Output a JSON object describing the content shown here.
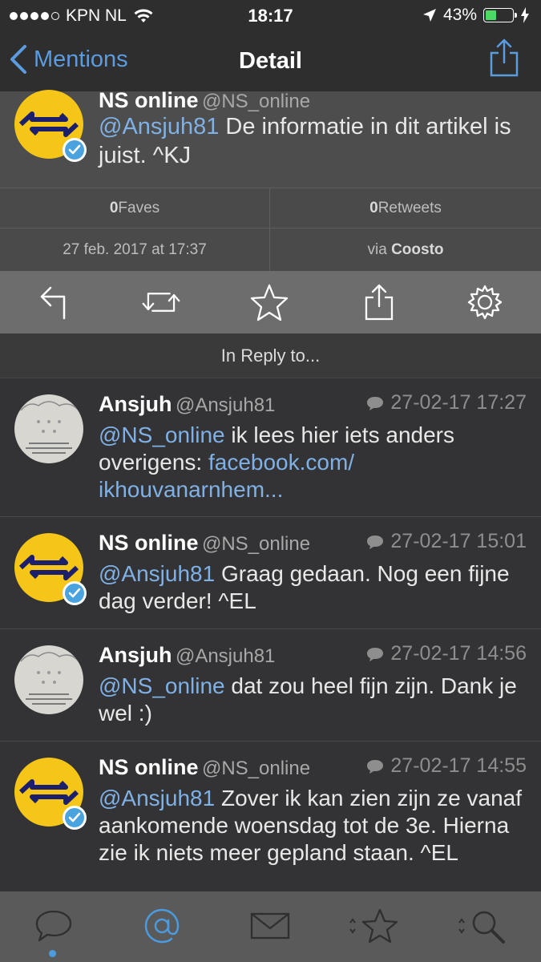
{
  "status_bar": {
    "carrier": "KPN NL",
    "time": "18:17",
    "battery": "43%",
    "battery_level": 0.43
  },
  "nav": {
    "back_label": "Mentions",
    "title": "Detail"
  },
  "main_tweet": {
    "name": "NS online",
    "handle": "@NS_online",
    "mention": "@Ansjuh81",
    "text": " De informatie in dit artikel is juist. ^KJ"
  },
  "stats": {
    "faves_count": "0",
    "faves_label": " Faves",
    "retweets_count": "0",
    "retweets_label": " Retweets",
    "date": "27 feb. 2017 at 17:37",
    "via_label": "via ",
    "via_source": "Coosto"
  },
  "actions": [
    "reply-icon",
    "retweet-icon",
    "star-icon",
    "share-icon",
    "gear-icon"
  ],
  "reply_header": "In Reply to...",
  "replies": [
    {
      "name": "Ansjuh",
      "handle": "@Ansjuh81",
      "time": "27-02-17 17:27",
      "mention": "@NS_online",
      "text": " ik lees hier iets anders overigens: ",
      "link": "facebook.com/ ikhouvanarnhem..."
    },
    {
      "name": "NS online",
      "handle": "@NS_online",
      "time": "27-02-17 15:01",
      "mention": "@Ansjuh81",
      "text": " Graag gedaan. Nog een fijne dag verder! ^EL"
    },
    {
      "name": "Ansjuh",
      "handle": "@Ansjuh81",
      "time": "27-02-17 14:56",
      "mention": "@NS_online",
      "text": " dat zou heel fijn zijn. Dank je wel :)"
    },
    {
      "name": "NS online",
      "handle": "@NS_online",
      "time": "27-02-17 14:55",
      "mention": "@Ansjuh81",
      "text": " Zover ik kan zien zijn ze vanaf aankomende woensdag tot de 3e. Hierna zie ik niets meer gepland staan. ^EL"
    }
  ],
  "tabs": [
    "speech-bubble-icon",
    "at-sign-icon",
    "envelope-icon",
    "sort-star-icon",
    "sort-search-icon"
  ],
  "colors": {
    "accent": "#5b9be0",
    "ns_yellow": "#f5c518",
    "ns_blue": "#1c1f6b"
  }
}
